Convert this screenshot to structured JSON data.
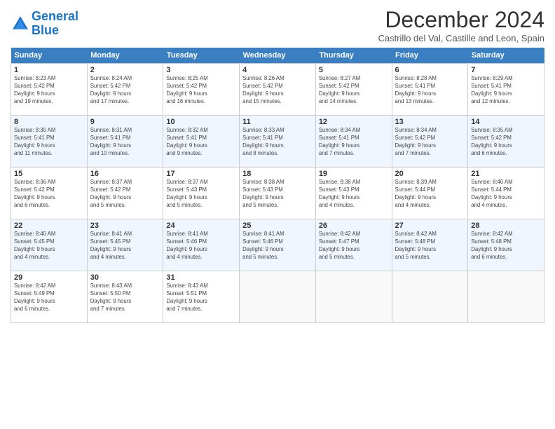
{
  "logo": {
    "line1": "General",
    "line2": "Blue"
  },
  "title": "December 2024",
  "subtitle": "Castrillo del Val, Castille and Leon, Spain",
  "days_header": [
    "Sunday",
    "Monday",
    "Tuesday",
    "Wednesday",
    "Thursday",
    "Friday",
    "Saturday"
  ],
  "weeks": [
    [
      {
        "day": "1",
        "info": "Sunrise: 8:23 AM\nSunset: 5:42 PM\nDaylight: 9 hours\nand 19 minutes."
      },
      {
        "day": "2",
        "info": "Sunrise: 8:24 AM\nSunset: 5:42 PM\nDaylight: 9 hours\nand 17 minutes."
      },
      {
        "day": "3",
        "info": "Sunrise: 8:25 AM\nSunset: 5:42 PM\nDaylight: 9 hours\nand 16 minutes."
      },
      {
        "day": "4",
        "info": "Sunrise: 8:26 AM\nSunset: 5:42 PM\nDaylight: 9 hours\nand 15 minutes."
      },
      {
        "day": "5",
        "info": "Sunrise: 8:27 AM\nSunset: 5:42 PM\nDaylight: 9 hours\nand 14 minutes."
      },
      {
        "day": "6",
        "info": "Sunrise: 8:28 AM\nSunset: 5:41 PM\nDaylight: 9 hours\nand 13 minutes."
      },
      {
        "day": "7",
        "info": "Sunrise: 8:29 AM\nSunset: 5:41 PM\nDaylight: 9 hours\nand 12 minutes."
      }
    ],
    [
      {
        "day": "8",
        "info": "Sunrise: 8:30 AM\nSunset: 5:41 PM\nDaylight: 9 hours\nand 11 minutes."
      },
      {
        "day": "9",
        "info": "Sunrise: 8:31 AM\nSunset: 5:41 PM\nDaylight: 9 hours\nand 10 minutes."
      },
      {
        "day": "10",
        "info": "Sunrise: 8:32 AM\nSunset: 5:41 PM\nDaylight: 9 hours\nand 9 minutes."
      },
      {
        "day": "11",
        "info": "Sunrise: 8:33 AM\nSunset: 5:41 PM\nDaylight: 9 hours\nand 8 minutes."
      },
      {
        "day": "12",
        "info": "Sunrise: 8:34 AM\nSunset: 5:41 PM\nDaylight: 9 hours\nand 7 minutes."
      },
      {
        "day": "13",
        "info": "Sunrise: 8:34 AM\nSunset: 5:42 PM\nDaylight: 9 hours\nand 7 minutes."
      },
      {
        "day": "14",
        "info": "Sunrise: 8:35 AM\nSunset: 5:42 PM\nDaylight: 9 hours\nand 6 minutes."
      }
    ],
    [
      {
        "day": "15",
        "info": "Sunrise: 8:36 AM\nSunset: 5:42 PM\nDaylight: 9 hours\nand 6 minutes."
      },
      {
        "day": "16",
        "info": "Sunrise: 8:37 AM\nSunset: 5:42 PM\nDaylight: 9 hours\nand 5 minutes."
      },
      {
        "day": "17",
        "info": "Sunrise: 8:37 AM\nSunset: 5:43 PM\nDaylight: 9 hours\nand 5 minutes."
      },
      {
        "day": "18",
        "info": "Sunrise: 8:38 AM\nSunset: 5:43 PM\nDaylight: 9 hours\nand 5 minutes."
      },
      {
        "day": "19",
        "info": "Sunrise: 8:38 AM\nSunset: 5:43 PM\nDaylight: 9 hours\nand 4 minutes."
      },
      {
        "day": "20",
        "info": "Sunrise: 8:39 AM\nSunset: 5:44 PM\nDaylight: 9 hours\nand 4 minutes."
      },
      {
        "day": "21",
        "info": "Sunrise: 8:40 AM\nSunset: 5:44 PM\nDaylight: 9 hours\nand 4 minutes."
      }
    ],
    [
      {
        "day": "22",
        "info": "Sunrise: 8:40 AM\nSunset: 5:45 PM\nDaylight: 9 hours\nand 4 minutes."
      },
      {
        "day": "23",
        "info": "Sunrise: 8:41 AM\nSunset: 5:45 PM\nDaylight: 9 hours\nand 4 minutes."
      },
      {
        "day": "24",
        "info": "Sunrise: 8:41 AM\nSunset: 5:46 PM\nDaylight: 9 hours\nand 4 minutes."
      },
      {
        "day": "25",
        "info": "Sunrise: 8:41 AM\nSunset: 5:46 PM\nDaylight: 9 hours\nand 5 minutes."
      },
      {
        "day": "26",
        "info": "Sunrise: 8:42 AM\nSunset: 5:47 PM\nDaylight: 9 hours\nand 5 minutes."
      },
      {
        "day": "27",
        "info": "Sunrise: 8:42 AM\nSunset: 5:48 PM\nDaylight: 9 hours\nand 5 minutes."
      },
      {
        "day": "28",
        "info": "Sunrise: 8:42 AM\nSunset: 5:48 PM\nDaylight: 9 hours\nand 6 minutes."
      }
    ],
    [
      {
        "day": "29",
        "info": "Sunrise: 8:42 AM\nSunset: 5:49 PM\nDaylight: 9 hours\nand 6 minutes."
      },
      {
        "day": "30",
        "info": "Sunrise: 8:43 AM\nSunset: 5:50 PM\nDaylight: 9 hours\nand 7 minutes."
      },
      {
        "day": "31",
        "info": "Sunrise: 8:43 AM\nSunset: 5:51 PM\nDaylight: 9 hours\nand 7 minutes."
      },
      {
        "day": "",
        "info": ""
      },
      {
        "day": "",
        "info": ""
      },
      {
        "day": "",
        "info": ""
      },
      {
        "day": "",
        "info": ""
      }
    ]
  ]
}
